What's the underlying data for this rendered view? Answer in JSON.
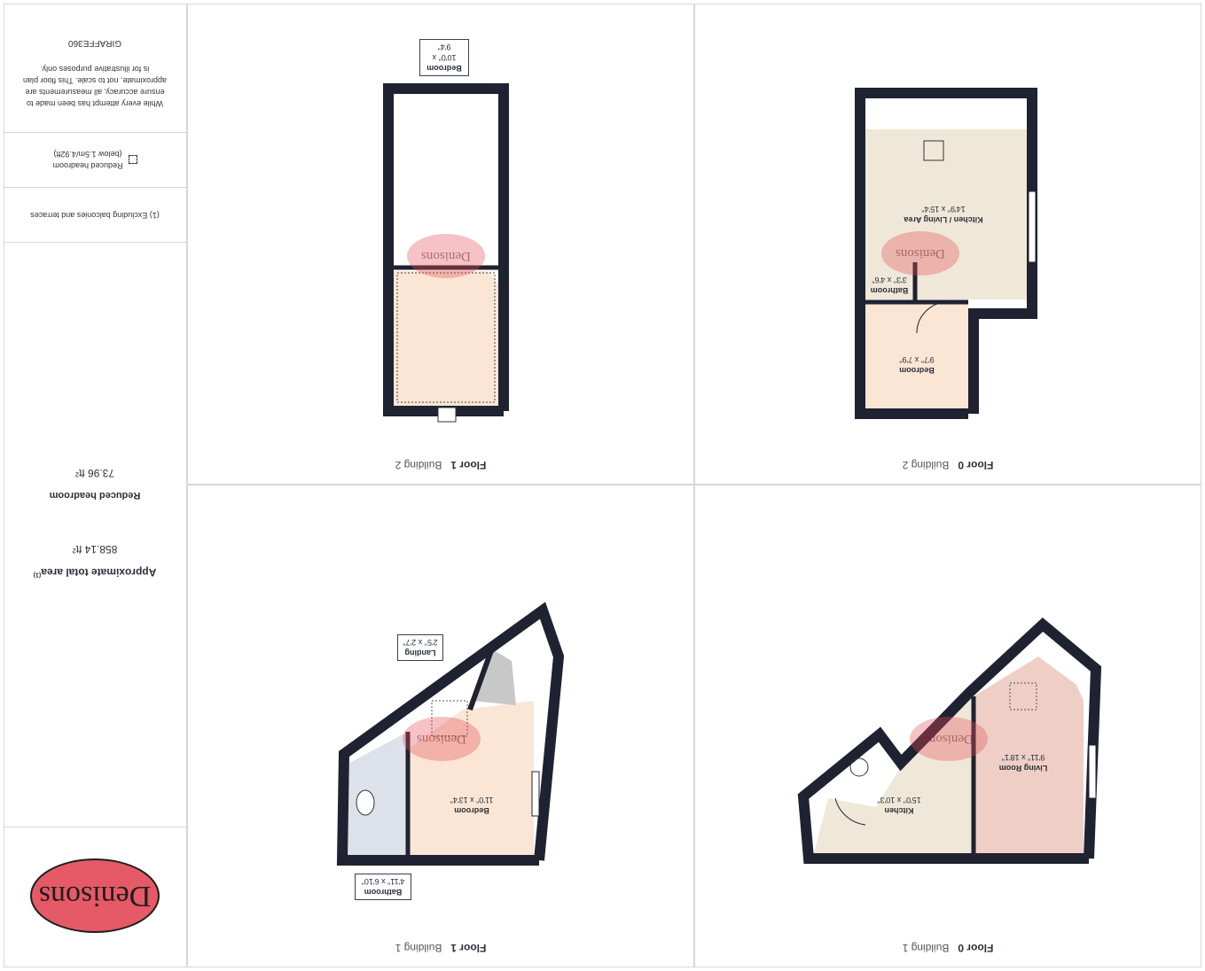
{
  "watermark": "Denisons",
  "panels": [
    {
      "floor": "Floor 0",
      "building": "Building 1"
    },
    {
      "floor": "Floor 1",
      "building": "Building 1"
    },
    {
      "floor": "Floor 0",
      "building": "Building 2"
    },
    {
      "floor": "Floor 1",
      "building": "Building 2"
    }
  ],
  "rooms": {
    "b1f0_living": {
      "name": "Living Room",
      "dims": "9'11\" x 18'1\""
    },
    "b1f0_kitchen": {
      "name": "Kitchen",
      "dims": "15'0\" x 10'3\""
    },
    "b1f1_bedroom": {
      "name": "Bedroom",
      "dims": "11'0\" x 13'4\""
    },
    "b1f1_bathroom": {
      "name": "Bathroom",
      "dims": "4'11\" x 6'10\""
    },
    "b1f1_landing": {
      "name": "Landing",
      "dims": "2'5\" x 2'7\""
    },
    "b2f0_kitchen": {
      "name": "Kitchen / Living Area",
      "dims": "14'9\" x 15'4\""
    },
    "b2f0_bathroom": {
      "name": "Bathroom",
      "dims": "3'3\" x 4'6\""
    },
    "b2f0_bedroom": {
      "name": "Bedroom",
      "dims": "9'7\" x 7'9\""
    },
    "b2f1_bedroom": {
      "name": "Bedroom",
      "dims": "10'0\" x 9'4\""
    }
  },
  "sidebar": {
    "logo_text": "Denisons",
    "total_area_label": "Approximate total area",
    "total_area_note": "(1)",
    "total_area_value": "858.14 ft²",
    "reduced_label": "Reduced headroom",
    "reduced_value": "73.96 ft²",
    "footnote": "(1) Excluding balconies and terraces",
    "legend_line1": "Reduced headroom",
    "legend_line2": "(below 1.5m/4.92ft)",
    "disclaimer": "While every attempt has been made to ensure accuracy, all measurements are approximate, not to scale. This floor plan is for illustrative purposes only.",
    "brand": "GIRAFFE360"
  },
  "colors": {
    "wall": "#1f2230",
    "beige": "#efe8d8",
    "peach": "#fbe6d5",
    "rose": "#efcfc5",
    "bath": "#dde1ea",
    "grey": "#c8c8c8",
    "logo": "#e55a66"
  }
}
